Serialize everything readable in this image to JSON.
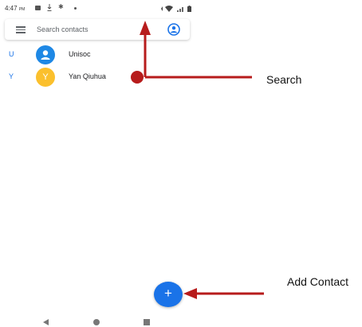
{
  "status_bar": {
    "time": "4:47",
    "ampm": "PM"
  },
  "search": {
    "placeholder": "Search contacts"
  },
  "contacts": [
    {
      "section": "U",
      "initial": "",
      "name": "Unisoc",
      "avatar_color": "#1e88e5"
    },
    {
      "section": "Y",
      "initial": "Y",
      "name": "Yan Qiuhua",
      "avatar_color": "#fbc02d"
    }
  ],
  "fab": {
    "label": "+"
  },
  "annotations": {
    "search_label": "Search",
    "add_contact_label": "Add Contact",
    "arrow_color": "#b71c1c"
  },
  "colors": {
    "accent": "#1a73e8"
  }
}
